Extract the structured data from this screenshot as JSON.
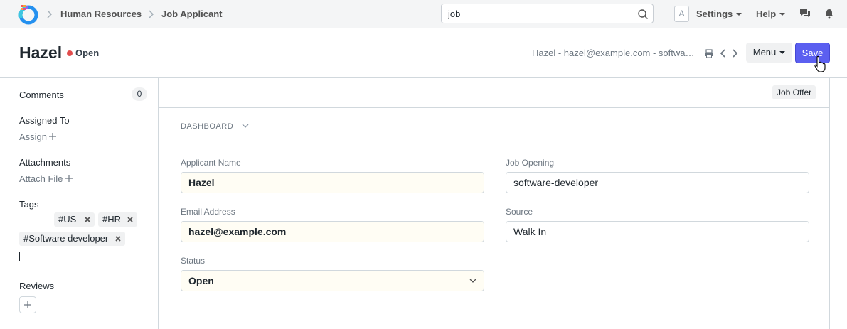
{
  "navbar": {
    "breadcrumbs": [
      "Human Resources",
      "Job Applicant"
    ],
    "search_value": "job",
    "avatar_initial": "A",
    "settings_label": "Settings",
    "help_label": "Help"
  },
  "page_head": {
    "title": "Hazel",
    "status": "Open",
    "status_color": "#e24c4c",
    "subtitle": "Hazel - hazel@example.com - software-developer",
    "menu_label": "Menu",
    "save_label": "Save"
  },
  "sidebar": {
    "comments_label": "Comments",
    "comments_count": "0",
    "assigned_to_label": "Assigned To",
    "assign_link": "Assign",
    "attachments_label": "Attachments",
    "attach_link": "Attach File",
    "tags_label": "Tags",
    "tags": [
      "#US",
      "#HR",
      "#Software developer"
    ],
    "reviews_label": "Reviews"
  },
  "form": {
    "job_offer_label": "Job Offer",
    "dashboard_label": "DASHBOARD",
    "applicant_name_label": "Applicant Name",
    "applicant_name_value": "Hazel",
    "job_opening_label": "Job Opening",
    "job_opening_value": "software-developer",
    "email_label": "Email Address",
    "email_value": "hazel@example.com",
    "source_label": "Source",
    "source_value": "Walk In",
    "status_label": "Status",
    "status_value": "Open"
  },
  "colors": {
    "primary": "#5b5ff0",
    "required_field_bg": "#fffdf4"
  }
}
